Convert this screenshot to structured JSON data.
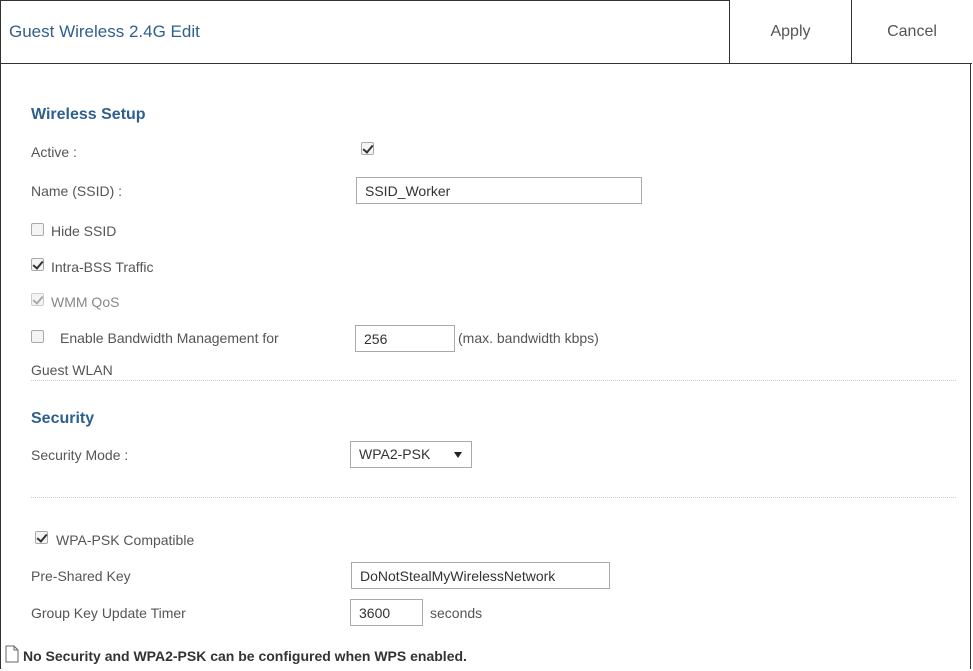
{
  "header": {
    "title": "Guest Wireless 2.4G Edit",
    "apply_label": "Apply",
    "cancel_label": "Cancel"
  },
  "wireless_setup": {
    "section_title": "Wireless Setup",
    "active_label": "Active :",
    "active_checked": true,
    "ssid_label": "Name (SSID) :",
    "ssid_value": "SSID_Worker",
    "hide_ssid_label": "Hide SSID",
    "hide_ssid_checked": false,
    "intra_bss_label": "Intra-BSS Traffic",
    "intra_bss_checked": true,
    "wmm_label": "WMM QoS",
    "wmm_checked": true,
    "bandwidth_label_line1": "Enable Bandwidth Management for",
    "bandwidth_label_line2": "Guest WLAN",
    "bandwidth_checked": false,
    "bandwidth_value": "256",
    "bandwidth_unit": "(max. bandwidth kbps)"
  },
  "security": {
    "section_title": "Security",
    "mode_label": "Security Mode :",
    "mode_value": "WPA2-PSK",
    "wpa_compat_label": "WPA-PSK Compatible",
    "wpa_compat_checked": true,
    "psk_label": "Pre-Shared Key",
    "psk_value": "DoNotStealMyWirelessNetwork",
    "timer_label": "Group Key Update Timer",
    "timer_value": "3600",
    "timer_unit": "seconds"
  },
  "note": {
    "icon": "document-icon",
    "text": "No Security and WPA2-PSK can be configured when WPS enabled."
  }
}
